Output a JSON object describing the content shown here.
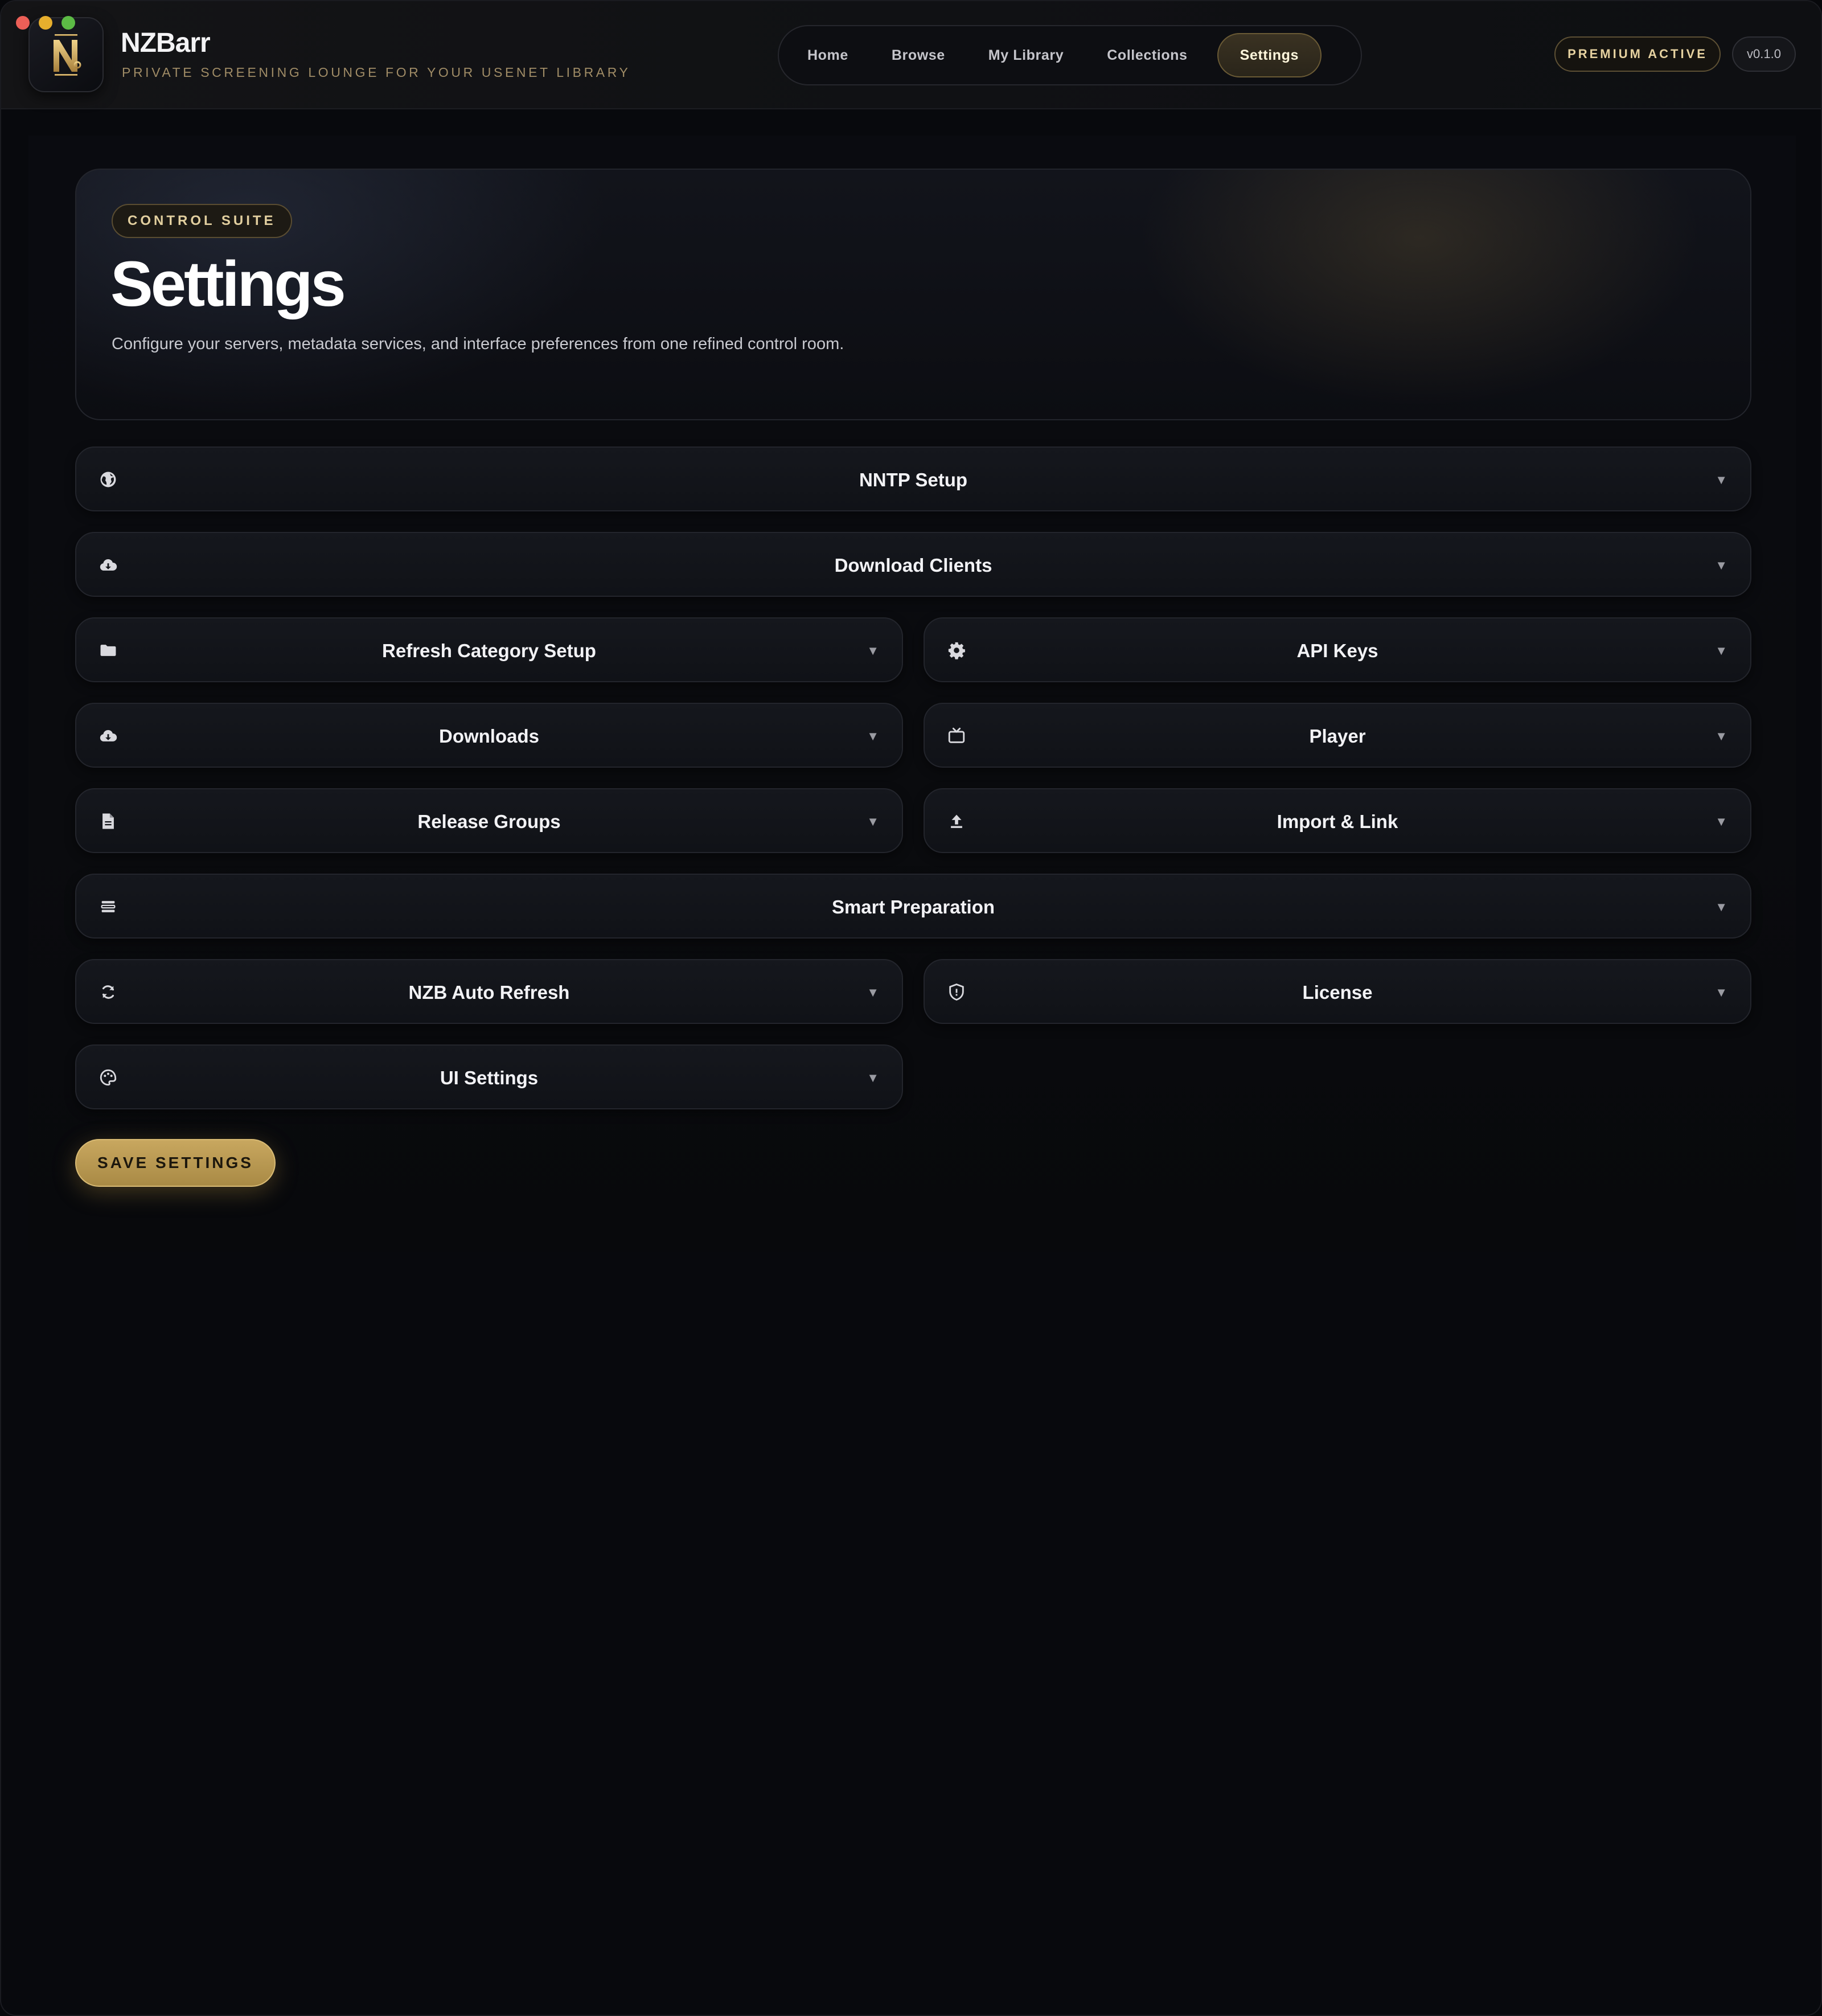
{
  "app": {
    "title": "NZBarr",
    "subtitle": "PRIVATE SCREENING LOUNGE FOR YOUR USENET LIBRARY",
    "logo_letter": "N"
  },
  "nav": {
    "items": [
      {
        "label": "Home",
        "active": false
      },
      {
        "label": "Browse",
        "active": false
      },
      {
        "label": "My Library",
        "active": false
      },
      {
        "label": "Collections",
        "active": false
      },
      {
        "label": "Settings",
        "active": true
      }
    ]
  },
  "header_right": {
    "premium_label": "PREMIUM ACTIVE",
    "version": "v0.1.0"
  },
  "hero": {
    "badge": "CONTROL SUITE",
    "title": "Settings",
    "description": "Configure your servers, metadata services, and interface preferences from one refined control room."
  },
  "panels": [
    {
      "label": "NNTP Setup",
      "icon": "globe-icon"
    },
    {
      "label": "Download Clients",
      "icon": "cloud-download-icon"
    },
    {
      "label": "Refresh Category Setup",
      "icon": "folder-icon"
    },
    {
      "label": "API Keys",
      "icon": "gear-icon"
    },
    {
      "label": "Downloads",
      "icon": "cloud-download-icon"
    },
    {
      "label": "Player",
      "icon": "tv-icon"
    },
    {
      "label": "Release Groups",
      "icon": "document-icon"
    },
    {
      "label": "Import & Link",
      "icon": "upload-icon"
    },
    {
      "label": "Smart Preparation",
      "icon": "stack-icon"
    },
    {
      "label": "NZB Auto Refresh",
      "icon": "refresh-icon"
    },
    {
      "label": "License",
      "icon": "shield-icon"
    },
    {
      "label": "UI Settings",
      "icon": "palette-icon"
    }
  ],
  "caret": "▼",
  "actions": {
    "save_label": "SAVE SETTINGS"
  },
  "colors": {
    "accent_gold": "#c8a75f",
    "background": "#08090d",
    "panel": "#13151b"
  }
}
